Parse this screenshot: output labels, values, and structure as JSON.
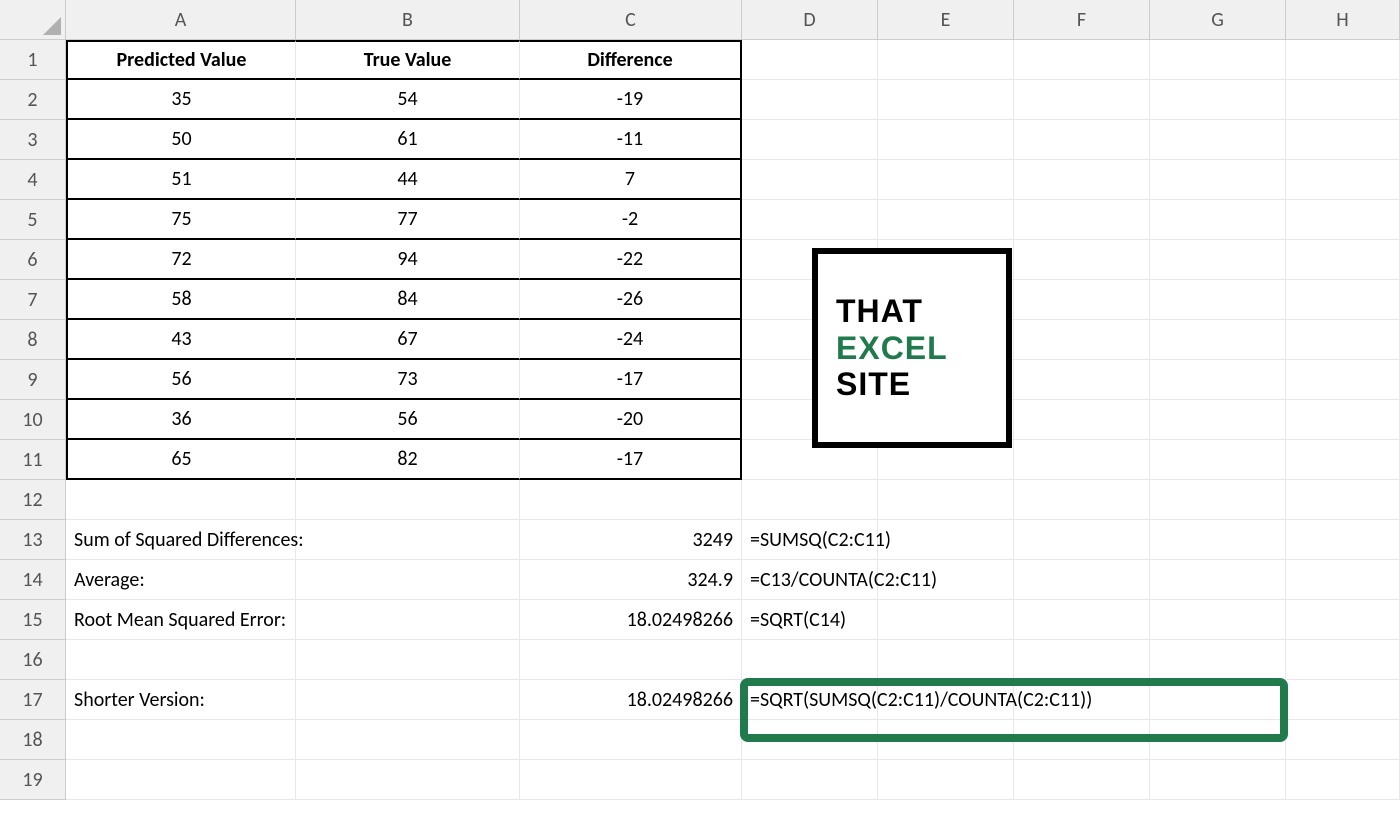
{
  "columns": [
    "A",
    "B",
    "C",
    "D",
    "E",
    "F",
    "G",
    "H"
  ],
  "rows": [
    "1",
    "2",
    "3",
    "4",
    "5",
    "6",
    "7",
    "8",
    "9",
    "10",
    "11",
    "12",
    "13",
    "14",
    "15",
    "16",
    "17",
    "18",
    "19"
  ],
  "headers": {
    "A": "Predicted Value",
    "B": "True Value",
    "C": "Difference"
  },
  "data_rows": [
    {
      "A": "35",
      "B": "54",
      "C": "-19"
    },
    {
      "A": "50",
      "B": "61",
      "C": "-11"
    },
    {
      "A": "51",
      "B": "44",
      "C": "7"
    },
    {
      "A": "75",
      "B": "77",
      "C": "-2"
    },
    {
      "A": "72",
      "B": "94",
      "C": "-22"
    },
    {
      "A": "58",
      "B": "84",
      "C": "-26"
    },
    {
      "A": "43",
      "B": "67",
      "C": "-24"
    },
    {
      "A": "56",
      "B": "73",
      "C": "-17"
    },
    {
      "A": "36",
      "B": "56",
      "C": "-20"
    },
    {
      "A": "65",
      "B": "82",
      "C": "-17"
    }
  ],
  "labels": {
    "sumsq": "Sum of Squared Differences:",
    "average": "Average:",
    "rmse": "Root Mean Squared Error:",
    "shorter": "Shorter Version:"
  },
  "results": {
    "sumsq": "3249",
    "average": "324.9",
    "rmse": "18.02498266",
    "shorter": "18.02498266"
  },
  "formulas": {
    "sumsq": "=SUMSQ(C2:C11)",
    "average": "=C13/COUNTA(C2:C11)",
    "rmse": "=SQRT(C14)",
    "shorter": "=SQRT(SUMSQ(C2:C11)/COUNTA(C2:C11))"
  },
  "logo": {
    "line1": "THAT",
    "line2": "EXCEL",
    "line3": "SITE"
  }
}
